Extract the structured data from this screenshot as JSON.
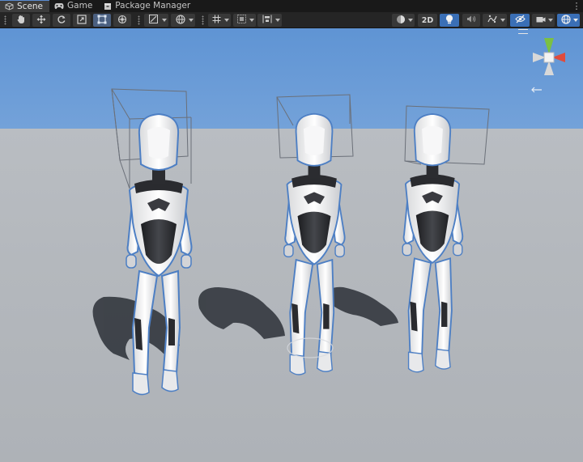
{
  "tabs": [
    {
      "label": "Scene",
      "icon": "scene-icon",
      "active": true
    },
    {
      "label": "Game",
      "icon": "gamepad-icon",
      "active": false
    },
    {
      "label": "Package Manager",
      "icon": "package-icon",
      "active": false
    }
  ],
  "tabbar": {
    "more_icon": "vertical-ellipsis-icon"
  },
  "toolbar": {
    "tools": [
      "hand-tool-icon",
      "move-tool-icon",
      "rotate-tool-icon",
      "scale-tool-icon",
      "rect-tool-icon",
      "transform-tool-icon"
    ],
    "mode_2d_label": "2D"
  },
  "colors": {
    "accent": "#3a6fb6",
    "active_toggle": "#4a5f80",
    "gizmo_y": "#7bc043",
    "gizmo_x": "#e04b3c",
    "selection_outline": "#6aa0e0"
  },
  "characters": [
    "robot-character-left",
    "robot-character-middle",
    "robot-character-right"
  ]
}
